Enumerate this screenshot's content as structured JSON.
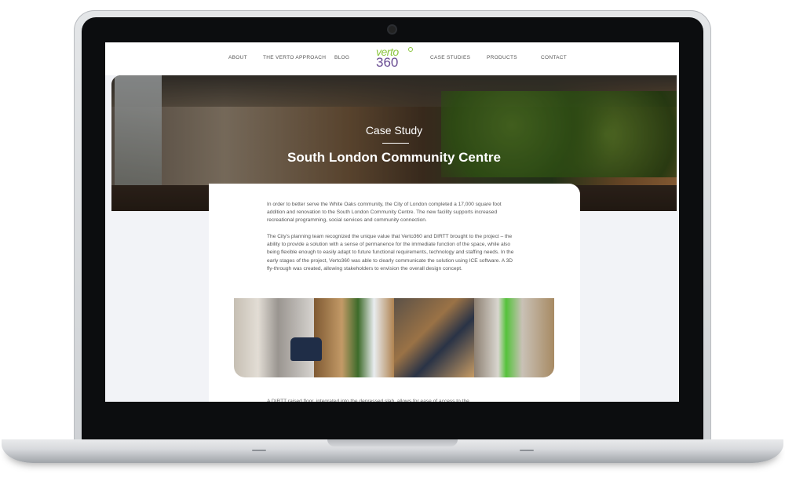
{
  "nav": {
    "left": [
      "ABOUT",
      "THE VERTO APPROACH",
      "BLOG"
    ],
    "right": [
      "CASE STUDIES",
      "PRODUCTS",
      "CONTACT"
    ]
  },
  "logo": {
    "top": "verto",
    "bottom": "360"
  },
  "hero": {
    "kicker": "Case Study",
    "title": "South London Community Centre"
  },
  "content": {
    "paragraph_1": "In order to better serve the White Oaks community, the City of London completed a 17,000 square foot addition and renovation to the South London Community Centre.  The new facility supports increased recreational programming, social services and community connection.",
    "paragraph_2": "The City's planning team recognized the unique value that Verto360 and DIRTT brought to the project – the ability to provide a solution with a sense of permanence for the immediate function of the space, while also being flexible enough to easily adapt to future functional requirements, technology and staffing needs.  In the early stages of the project, Verto360 was able to clearly communicate the solution using ICE software.  A 3D fly-through was created, allowing stakeholders to envision the overall design concept.",
    "paragraph_3_partial": "A DIRTT raised floor, integrated into the depressed slab, allows for ease of access to the"
  },
  "colors": {
    "logo_green": "#8cc63f",
    "logo_purple": "#6a4d93",
    "page_bg": "#f2f3f7"
  }
}
